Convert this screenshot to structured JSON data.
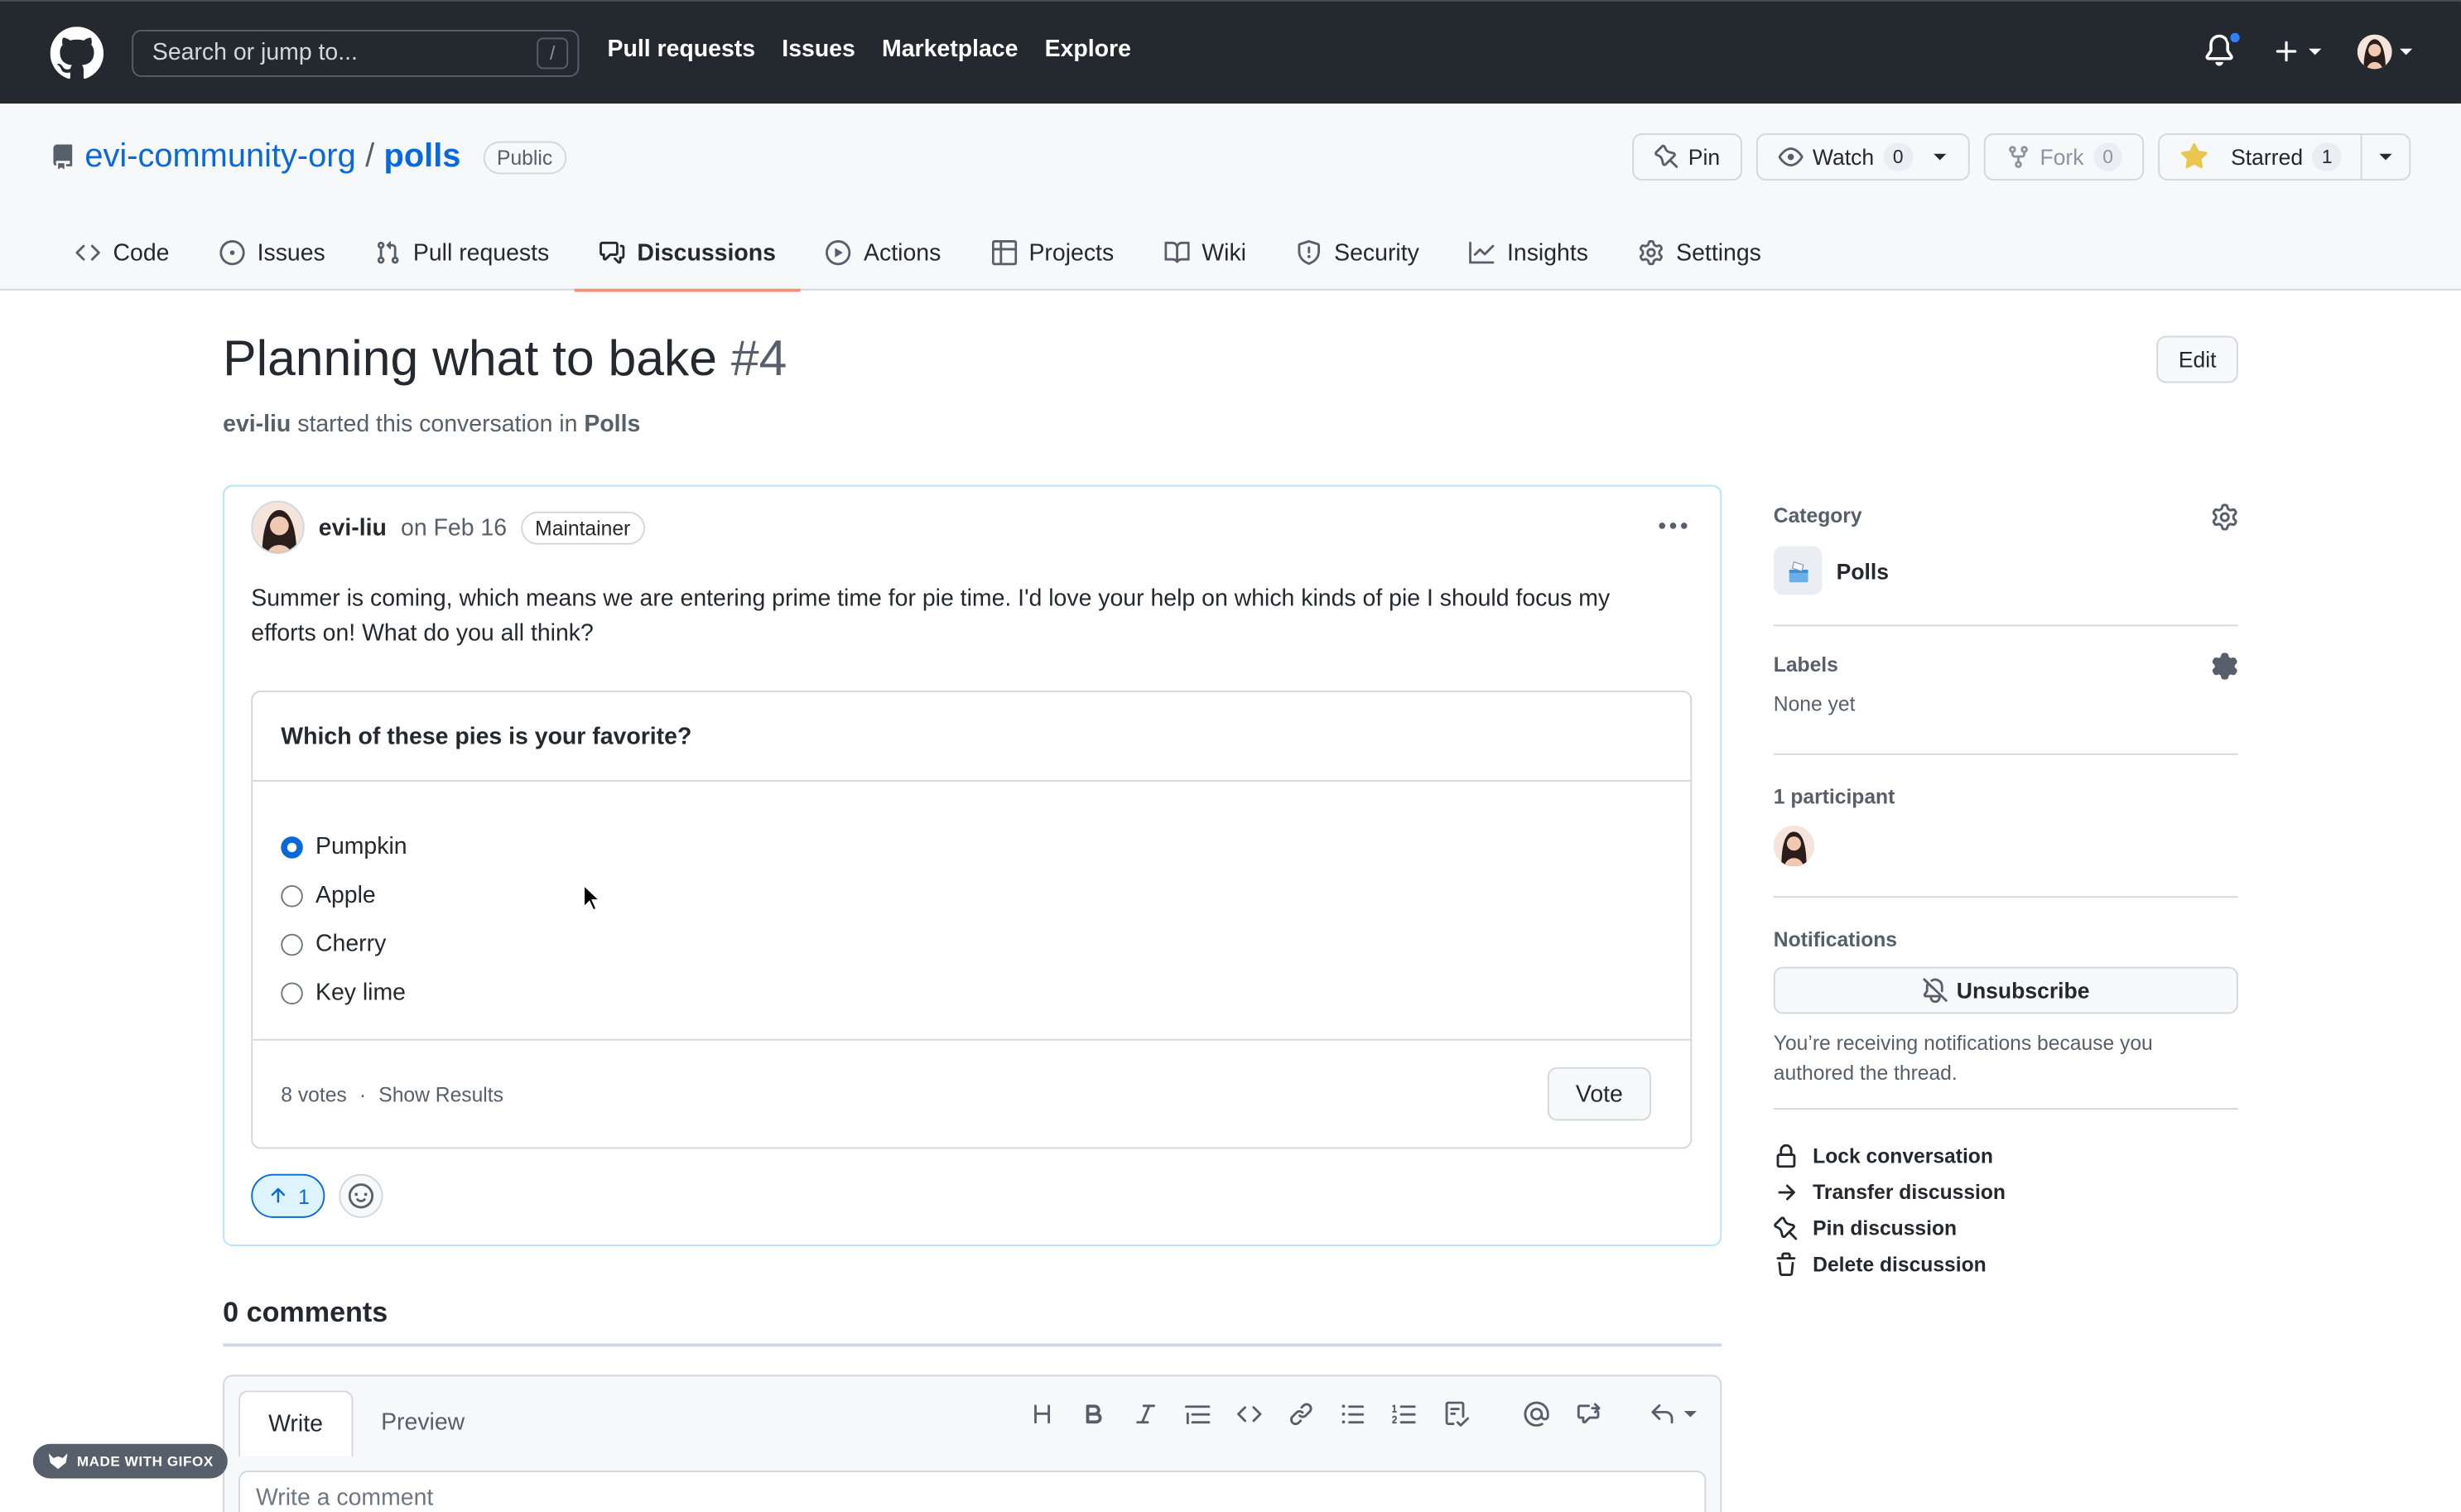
{
  "header": {
    "search_placeholder": "Search or jump to...",
    "search_shortcut": "/",
    "nav": [
      "Pull requests",
      "Issues",
      "Marketplace",
      "Explore"
    ]
  },
  "repo": {
    "owner": "evi-community-org",
    "separator": "/",
    "name": "polls",
    "visibility": "Public",
    "pin_label": "Pin",
    "watch_label": "Watch",
    "watch_count": "0",
    "fork_label": "Fork",
    "fork_count": "0",
    "star_label": "Starred",
    "star_count": "1",
    "tabs": [
      {
        "label": "Code",
        "icon": "code-icon"
      },
      {
        "label": "Issues",
        "icon": "issue-icon"
      },
      {
        "label": "Pull requests",
        "icon": "pull-request-icon"
      },
      {
        "label": "Discussions",
        "icon": "discussion-icon",
        "active": true
      },
      {
        "label": "Actions",
        "icon": "play-icon"
      },
      {
        "label": "Projects",
        "icon": "table-icon"
      },
      {
        "label": "Wiki",
        "icon": "book-icon"
      },
      {
        "label": "Security",
        "icon": "shield-icon"
      },
      {
        "label": "Insights",
        "icon": "graph-icon"
      },
      {
        "label": "Settings",
        "icon": "gear-icon"
      }
    ]
  },
  "discussion": {
    "title": "Planning what to bake",
    "number": "#4",
    "author": "evi-liu",
    "started_text": "started this conversation in",
    "category": "Polls",
    "edit_label": "Edit"
  },
  "post": {
    "author": "evi-liu",
    "date": "on Feb 16",
    "badge": "Maintainer",
    "body": "Summer is coming, which means we are entering prime time for pie time. I'd love your help on which kinds of pie I should focus my efforts on! What do you all think?",
    "poll": {
      "question": "Which of these pies is your favorite?",
      "options": [
        {
          "label": "Pumpkin",
          "selected": true
        },
        {
          "label": "Apple",
          "selected": false
        },
        {
          "label": "Cherry",
          "selected": false
        },
        {
          "label": "Key lime",
          "selected": false
        }
      ],
      "votes": "8 votes",
      "separator": "·",
      "show_results": "Show Results",
      "vote_label": "Vote"
    },
    "upvote_count": "1"
  },
  "comments": {
    "title": "0 comments",
    "write_tab": "Write",
    "preview_tab": "Preview",
    "placeholder": "Write a comment"
  },
  "sidebar": {
    "category_label": "Category",
    "category_name": "Polls",
    "labels_label": "Labels",
    "labels_value": "None yet",
    "participants_label": "1 participant",
    "notifications_label": "Notifications",
    "unsubscribe_label": "Unsubscribe",
    "notification_reason": "You’re receiving notifications because you authored the thread.",
    "actions": [
      {
        "label": "Lock conversation",
        "icon": "lock-icon"
      },
      {
        "label": "Transfer discussion",
        "icon": "arrow-right-icon"
      },
      {
        "label": "Pin discussion",
        "icon": "pin-icon"
      },
      {
        "label": "Delete discussion",
        "icon": "trash-icon"
      }
    ]
  },
  "watermark": "MADE WITH GIFOX",
  "colors": {
    "header_bg": "#24292f",
    "link": "#0969da",
    "active_tab_underline": "#fd8c73",
    "star": "#eac54f"
  }
}
